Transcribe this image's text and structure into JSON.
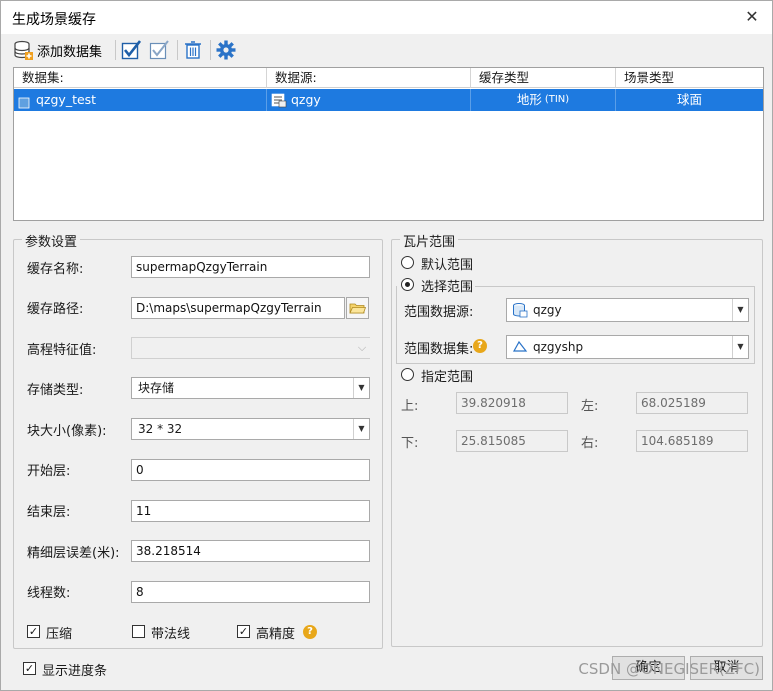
{
  "window": {
    "title": "生成场景缓存",
    "close": "✕"
  },
  "toolbar": {
    "add_label": "添加数据集"
  },
  "grid": {
    "columns": [
      "数据集:",
      "数据源:",
      "缓存类型",
      "场景类型"
    ],
    "rows": [
      {
        "dataset": "qzgy_test",
        "datasource": "qzgy",
        "cache_type": "地形",
        "cache_type_suffix": "(TIN)",
        "scene_type": "球面"
      }
    ]
  },
  "params": {
    "legend": "参数设置",
    "cache_name_label": "缓存名称:",
    "cache_name": "supermapQzgyTerrain",
    "cache_path_label": "缓存路径:",
    "cache_path": "D:\\maps\\supermapQzgyTerrain",
    "elev_label": "高程特征值:",
    "elev_value": "",
    "storage_label": "存储类型:",
    "storage_value": "块存储",
    "block_label": "块大小(像素):",
    "block_value": "32 * 32",
    "start_label": "开始层:",
    "start_value": "0",
    "end_label": "结束层:",
    "end_value": "11",
    "fine_label": "精细层误差(米):",
    "fine_value": "38.218514",
    "threads_label": "线程数:",
    "threads_value": "8",
    "compress_label": "压缩",
    "compress_checked": true,
    "normal_label": "带法线",
    "normal_checked": false,
    "precision_label": "高精度",
    "precision_checked": true
  },
  "tile": {
    "legend": "瓦片范围",
    "default_label": "默认范围",
    "select_label": "选择范围",
    "range_source_label": "范围数据源:",
    "range_source_value": "qzgy",
    "range_dataset_label": "范围数据集:",
    "range_dataset_value": "qzgyshp",
    "specify_label": "指定范围",
    "top_label": "上:",
    "top_value": "39.820918",
    "left_label": "左:",
    "left_value": "68.025189",
    "bottom_label": "下:",
    "bottom_value": "25.815085",
    "right_label": "右:",
    "right_value": "104.685189"
  },
  "footer": {
    "show_progress_label": "显示进度条",
    "show_progress_checked": true,
    "ok_label": "确定",
    "cancel_label": "取消",
    "watermark": "CSDN @ONEGISER(ZFC)"
  },
  "colors": {
    "selection": "#1e7ae0",
    "check_blue": "#1f5fa8",
    "gear_blue": "#2a73c8",
    "help_orange": "#e8a71a"
  }
}
